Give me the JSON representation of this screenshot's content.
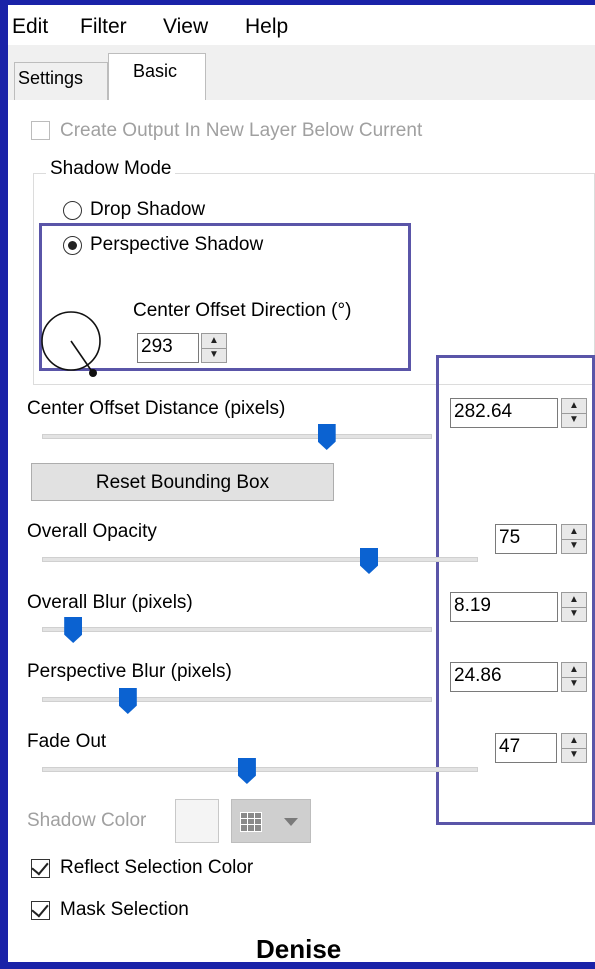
{
  "menu": [
    "Edit",
    "Filter",
    "View",
    "Help"
  ],
  "tabs": {
    "settings": "Settings",
    "basic": "Basic"
  },
  "create_output": {
    "label": "Create Output In New Layer Below Current",
    "checked": false,
    "enabled": false
  },
  "shadow_mode": {
    "title": "Shadow Mode",
    "drop_shadow": {
      "label": "Drop Shadow",
      "selected": false
    },
    "perspective_shadow": {
      "label": "Perspective Shadow",
      "selected": true
    }
  },
  "center_offset_direction": {
    "label": "Center Offset Direction (°)",
    "value": "293"
  },
  "center_offset_distance": {
    "label": "Center Offset Distance (pixels)",
    "value": "282.64",
    "slider_fraction": 0.73
  },
  "reset_bounding_box": {
    "label": "Reset Bounding Box"
  },
  "overall_opacity": {
    "label": "Overall Opacity",
    "value": "75",
    "slider_fraction": 0.75
  },
  "overall_blur": {
    "label": "Overall Blur (pixels)",
    "value": "8.19",
    "slider_fraction": 0.08
  },
  "perspective_blur": {
    "label": "Perspective Blur (pixels)",
    "value": "24.86",
    "slider_fraction": 0.22
  },
  "fade_out": {
    "label": "Fade Out",
    "value": "47",
    "slider_fraction": 0.47
  },
  "shadow_color": {
    "label": "Shadow Color",
    "enabled": false
  },
  "reflect_selection_color": {
    "label": "Reflect Selection Color",
    "checked": true
  },
  "mask_selection": {
    "label": "Mask Selection",
    "checked": true
  },
  "footer_signature": "Denise",
  "icons": {
    "spin_up": "spin-up-arrow-icon",
    "spin_down": "spin-down-arrow-icon",
    "direction_dial": "direction-dial-icon",
    "palette_grid": "palette-grid-icon",
    "dropdown": "chevron-down-icon"
  },
  "colors": {
    "highlight": "#5a55a8",
    "slider_thumb": "#0b62d1",
    "frame": "#1a22a8"
  }
}
